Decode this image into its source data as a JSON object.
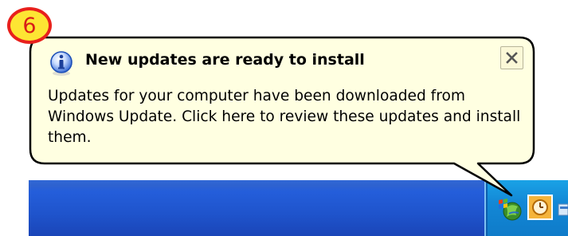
{
  "step": {
    "number": "6"
  },
  "balloon": {
    "title": "New updates are ready to install",
    "body": "Updates for your computer have been downloaded from Windows Update. Click here to review these updates and install them.",
    "icon": "info-icon",
    "close_icon": "close-icon",
    "background_color": "#ffffe1"
  },
  "taskbar": {
    "color": "#245edb",
    "tray_color": "#0f8ad7",
    "tray_icons": [
      "windows-update-icon",
      "clock-icon"
    ]
  }
}
